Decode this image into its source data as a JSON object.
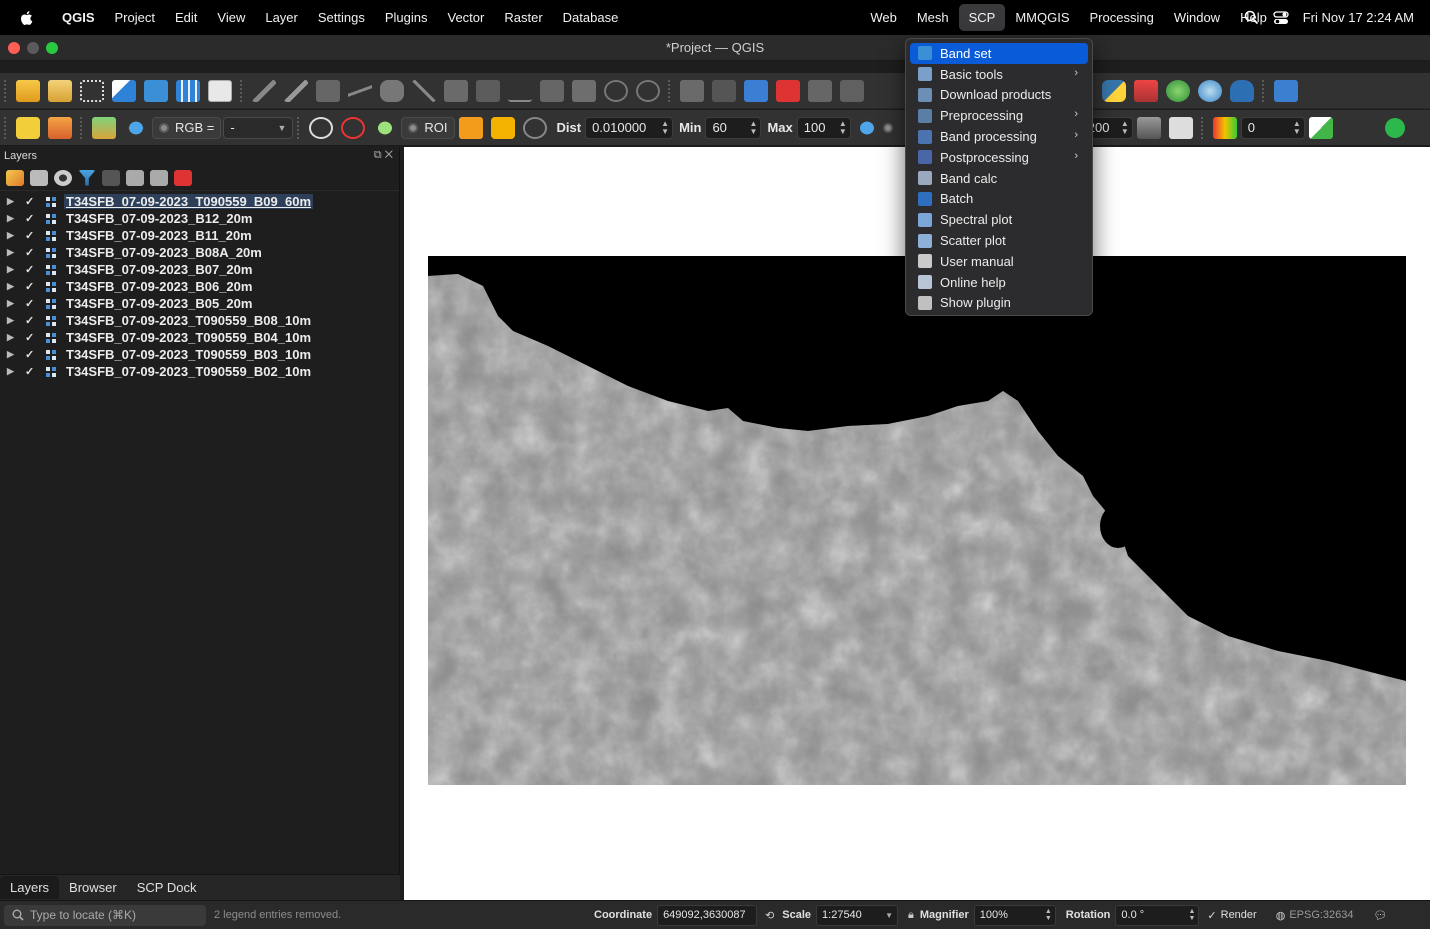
{
  "menubar": {
    "app": "QGIS",
    "items": [
      "Project",
      "Edit",
      "View",
      "Layer",
      "Settings",
      "Plugins",
      "Vector",
      "Raster",
      "Database"
    ],
    "right_items": [
      "Web",
      "Mesh",
      "SCP",
      "MMQGIS",
      "Processing",
      "Window",
      "Help"
    ],
    "active": "SCP",
    "clock": "Fri Nov 17  2:24 AM"
  },
  "window": {
    "title": "*Project — QGIS"
  },
  "scp_toolbar": {
    "rgb_label": "RGB =",
    "rgb_value": "-",
    "roi_label": "ROI",
    "dist_label": "Dist",
    "dist_value": "0.010000",
    "min_label": "Min",
    "min_value": "60",
    "max_label": "Max",
    "max_value": "100",
    "right_value": "200",
    "right_value2": "0"
  },
  "layers_panel": {
    "title": "Layers",
    "layers": [
      "T34SFB_07-09-2023_T090559_B09_60m",
      "T34SFB_07-09-2023_B12_20m",
      "T34SFB_07-09-2023_B11_20m",
      "T34SFB_07-09-2023_B08A_20m",
      "T34SFB_07-09-2023_B07_20m",
      "T34SFB_07-09-2023_B06_20m",
      "T34SFB_07-09-2023_B05_20m",
      "T34SFB_07-09-2023_T090559_B08_10m",
      "T34SFB_07-09-2023_T090559_B04_10m",
      "T34SFB_07-09-2023_T090559_B03_10m",
      "T34SFB_07-09-2023_T090559_B02_10m"
    ],
    "tabs": [
      "Layers",
      "Browser",
      "SCP Dock"
    ],
    "active_tab": "Layers"
  },
  "scp_menu": {
    "items": [
      {
        "label": "Band set",
        "submenu": false,
        "highlighted": true
      },
      {
        "label": "Basic tools",
        "submenu": true
      },
      {
        "label": "Download products",
        "submenu": false
      },
      {
        "label": "Preprocessing",
        "submenu": true
      },
      {
        "label": "Band processing",
        "submenu": true
      },
      {
        "label": "Postprocessing",
        "submenu": true
      },
      {
        "label": "Band calc",
        "submenu": false
      },
      {
        "label": "Batch",
        "submenu": false
      },
      {
        "label": "Spectral plot",
        "submenu": false
      },
      {
        "label": "Scatter plot",
        "submenu": false
      },
      {
        "label": "User manual",
        "submenu": false
      },
      {
        "label": "Online help",
        "submenu": false
      },
      {
        "label": "Show plugin",
        "submenu": false
      }
    ]
  },
  "statusbar": {
    "locate_placeholder": "Type to locate (⌘K)",
    "message": "2 legend entries removed.",
    "coordinate_label": "Coordinate",
    "coordinate_value": "649092,3630087",
    "scale_label": "Scale",
    "scale_value": "1:27540",
    "magnifier_label": "Magnifier",
    "magnifier_value": "100%",
    "rotation_label": "Rotation",
    "rotation_value": "0.0 °",
    "render_label": "Render",
    "crs": "EPSG:32634"
  },
  "colors": {
    "menu_highlight": "#0a5bd8",
    "map_background": "#ffffff",
    "raster_nodata": "#000000"
  }
}
